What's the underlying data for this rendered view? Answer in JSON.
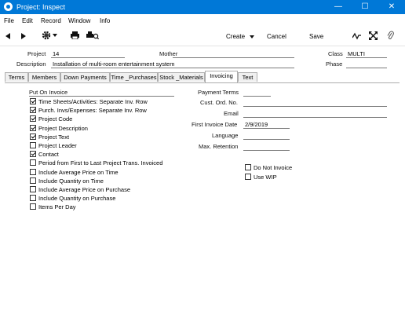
{
  "window": {
    "title": "Project: Inspect"
  },
  "menu": [
    "File",
    "Edit",
    "Record",
    "Window",
    "Info"
  ],
  "toolbar": {
    "create": "Create",
    "cancel": "Cancel",
    "save": "Save"
  },
  "header": {
    "project_label": "Project",
    "project_value": "14",
    "mother_label": "Mother",
    "mother_value": "",
    "class_label": "Class",
    "class_value": "MULTI",
    "description_label": "Description",
    "description_value": "Installation of multi-room entertainment system",
    "phase_label": "Phase",
    "phase_value": ""
  },
  "tabs": [
    "Terms",
    "Members",
    "Down Payments",
    "Time _Purchases",
    "Stock _Materials",
    "Invoicing",
    "Text"
  ],
  "active_tab": "Invoicing",
  "invoicing": {
    "put_on_invoice_label": "Put On Invoice",
    "checkboxes": [
      {
        "label": "Time Sheets/Activities: Separate Inv. Row",
        "checked": true
      },
      {
        "label": "Purch. Invs/Expenses: Separate Inv. Row",
        "checked": true
      },
      {
        "label": "Project Code",
        "checked": true
      },
      {
        "label": "Project Description",
        "checked": true
      },
      {
        "label": "Project Text",
        "checked": true
      },
      {
        "label": "Project Leader",
        "checked": false
      },
      {
        "label": "Contact",
        "checked": true
      },
      {
        "label": "Period from First to Last Project Trans. Invoiced",
        "checked": false
      },
      {
        "label": "Include Average Price on Time",
        "checked": false
      },
      {
        "label": "Include Quantity on Time",
        "checked": false
      },
      {
        "label": "Include Average Price on Purchase",
        "checked": false
      },
      {
        "label": "Include Quantity on Purchase",
        "checked": false
      },
      {
        "label": "Items Per Day",
        "checked": false
      }
    ],
    "payment_terms_label": "Payment Terms",
    "payment_terms_value": "",
    "cust_ord_no_label": "Cust. Ord. No.",
    "cust_ord_no_value": "",
    "email_label": "Email",
    "email_value": "",
    "first_invoice_date_label": "First Invoice Date",
    "first_invoice_date_value": "2/9/2019",
    "language_label": "Language",
    "language_value": "",
    "max_retention_label": "Max. Retention",
    "max_retention_value": "",
    "do_not_invoice_label": "Do Not Invoice",
    "do_not_invoice_checked": false,
    "use_wip_label": "Use WIP",
    "use_wip_checked": false
  }
}
